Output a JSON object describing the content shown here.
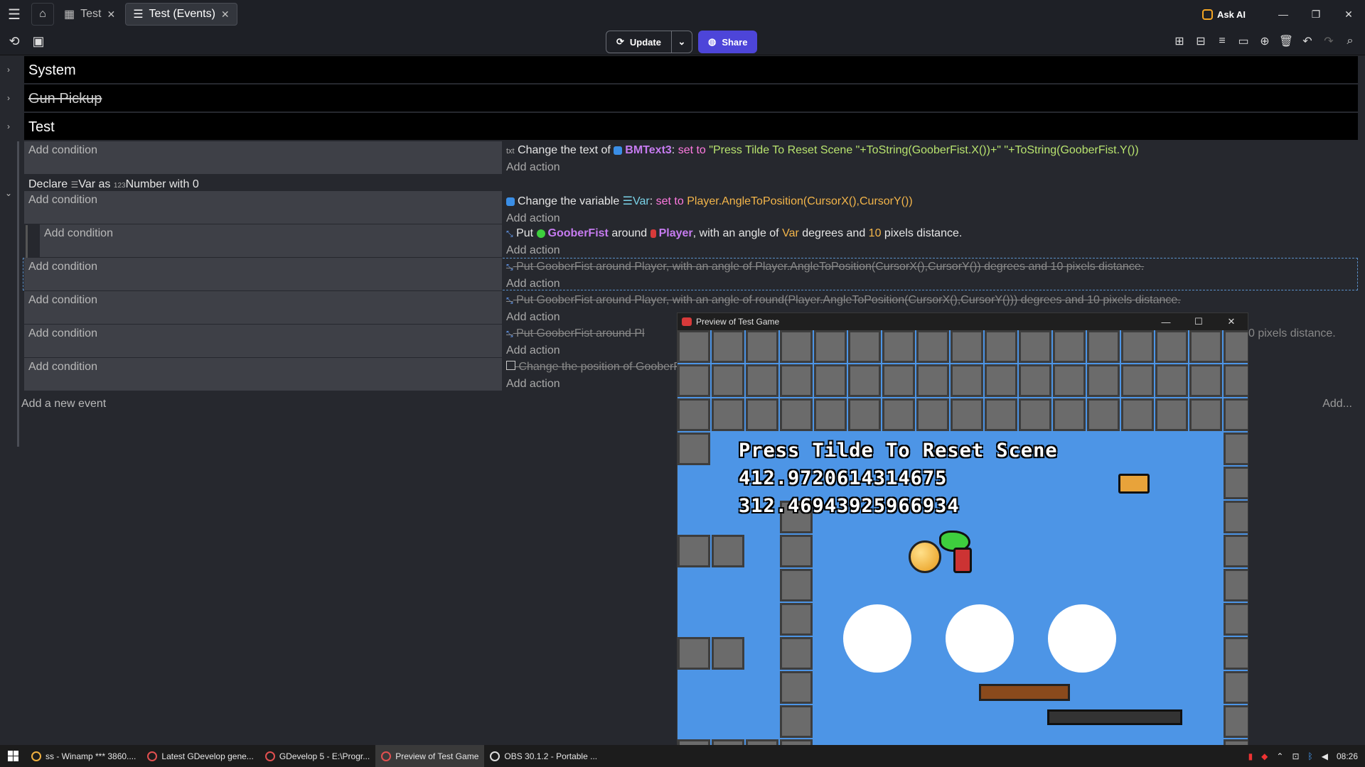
{
  "tabs": [
    {
      "label": "Test"
    },
    {
      "label": "Test (Events)"
    }
  ],
  "title_right": {
    "ask_ai": "Ask AI"
  },
  "toolbar": {
    "update_label": "Update",
    "share_label": "Share"
  },
  "groups": [
    {
      "label": "System",
      "disabled": false
    },
    {
      "label": "Gun Pickup",
      "disabled": true
    },
    {
      "label": "Test",
      "disabled": false
    }
  ],
  "events": {
    "add_condition": "Add condition",
    "add_action": "Add action",
    "e1": {
      "a1": "Change the text of",
      "a2": "BMText3",
      "a3": ": ",
      "a4": "set to",
      "a5": "\"Press Tilde To Reset Scene \"+ToString(GooberFist.X())+\" \"+ToString(GooberFist.Y())"
    },
    "declare": {
      "p1": "Declare",
      "p2": "Var",
      "p3": "as",
      "p4": "Number",
      "p5": "with 0"
    },
    "e2": {
      "a1": "Change the variable",
      "a2": "Var",
      "a3": ": ",
      "a4": "set to",
      "a5": "Player.AngleToPosition(CursorX(),CursorY())"
    },
    "e3": {
      "a1": "Put",
      "a2": "GooberFist",
      "a3": "around",
      "a4": "Player",
      "a5": ", with an angle of",
      "a6": "Var",
      "a7": "degrees and",
      "a8": "10",
      "a9": "pixels distance."
    },
    "e4": "Put GooberFist around Player, with an angle of Player.AngleToPosition(CursorX(),CursorY()) degrees and 10 pixels distance.",
    "e5": "Put GooberFist around Player, with an angle of round(Player.AngleToPosition(CursorX(),CursorY())) degrees and 10 pixels distance.",
    "e6_left": "Put GooberFist around Pl",
    "e6_right": "0 pixels distance.",
    "e7": "Change the position of GooberFist",
    "add_event": "Add a new event",
    "add_more": "Add..."
  },
  "preview": {
    "title": "Preview of Test Game",
    "hud_lines": [
      "Press Tilde To Reset Scene",
      "412.9720614314675",
      "312.46943925966934"
    ]
  },
  "taskbar": {
    "tasks": [
      "ss - Winamp *** 3860....",
      "Latest GDevelop gene...",
      "GDevelop 5 - E:\\Progr...",
      "Preview of Test Game",
      "OBS 30.1.2 - Portable ..."
    ],
    "time": "08:26"
  },
  "colors": {
    "accent": "#4d45d9",
    "group_bg": "#000000",
    "condition_bg": "#3e4047",
    "game_bg": "#4d95e6"
  }
}
